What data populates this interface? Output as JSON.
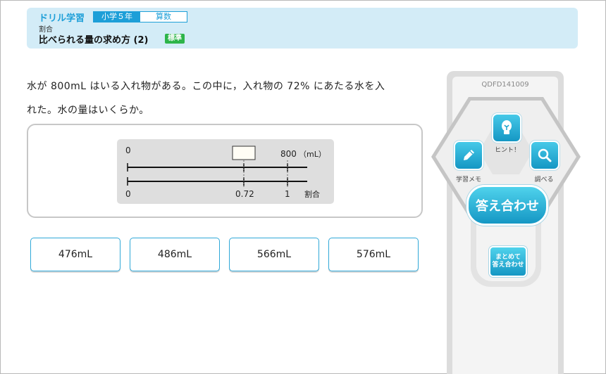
{
  "header": {
    "title": "ドリル学習",
    "grade": "小学５年",
    "subject": "算数",
    "unit": "割合",
    "lesson": "比べられる量の求め方 (2)",
    "level": "標準"
  },
  "question": {
    "line1": "水が 800mL はいる入れ物がある。この中に，入れ物の 72% にあたる水を入",
    "line2": "れた。水の量はいくらか。"
  },
  "diagram": {
    "top_zero": "0",
    "top_max": "800",
    "top_unit": "（mL）",
    "bottom_zero": "0",
    "bottom_mid": "0.72",
    "bottom_max": "1",
    "bottom_unit": "割合",
    "answer_box_value": ""
  },
  "answers": [
    "476mL",
    "486mL",
    "566mL",
    "576mL"
  ],
  "side": {
    "problem_id": "QDFD141009",
    "hint": "ヒント！",
    "memo": "学習メモ",
    "lookup": "調べる",
    "check": "答え合わせ",
    "batch_line1": "まとめて",
    "batch_line2": "答え合わせ"
  }
}
